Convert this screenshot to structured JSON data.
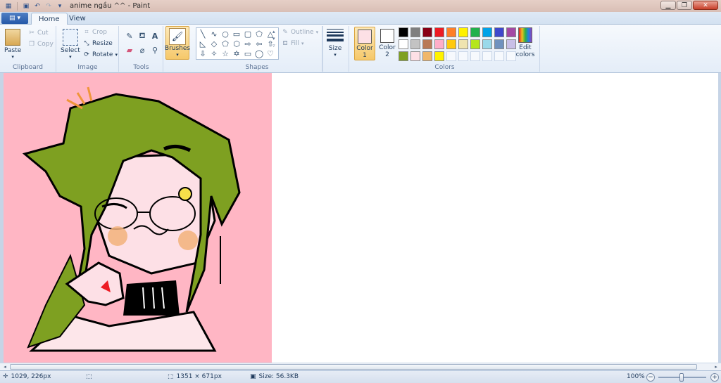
{
  "window": {
    "title": "anime ngầu ^^ - Paint"
  },
  "tabs": {
    "home": "Home",
    "view": "View"
  },
  "ribbon": {
    "clipboard": {
      "label": "Clipboard",
      "paste": "Paste",
      "cut": "Cut",
      "copy": "Copy"
    },
    "image": {
      "label": "Image",
      "select": "Select",
      "crop": "Crop",
      "resize": "Resize",
      "rotate": "Rotate"
    },
    "tools": {
      "label": "Tools",
      "brushes": "Brushes"
    },
    "shapes": {
      "label": "Shapes",
      "outline": "Outline",
      "fill": "Fill",
      "size": "Size"
    },
    "colors": {
      "label": "Colors",
      "color1": "Color 1",
      "color2": "Color 2",
      "edit": "Edit colors",
      "color1_value": "#fde0e6",
      "color2_value": "#ffffff",
      "palette": [
        "#000000",
        "#7f7f7f",
        "#880015",
        "#ed1c24",
        "#ff7f27",
        "#fff200",
        "#22b14c",
        "#00a2e8",
        "#3f48cc",
        "#a349a4",
        "#ffffff",
        "#c3c3c3",
        "#b97a57",
        "#ffaec9",
        "#ffc90e",
        "#efe4b0",
        "#b5e61d",
        "#99d9ea",
        "#7092be",
        "#c8bfe7",
        "#7ea021",
        "#fde0e6",
        "#f0b76a",
        "#fff200",
        "",
        "",
        "",
        "",
        "",
        ""
      ]
    }
  },
  "canvas": {
    "background": "#ffffff",
    "art_background": "#ffb6c4"
  },
  "status": {
    "cursor_pos": "1029, 226px",
    "selection_size": "",
    "image_size": "1351 × 671px",
    "file_size": "Size: 56.3KB",
    "zoom": "100%"
  }
}
